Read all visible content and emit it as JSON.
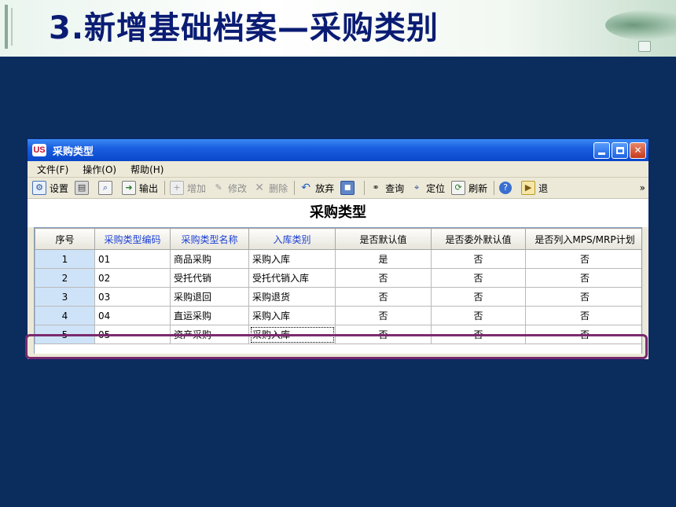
{
  "slide": {
    "title": "3.新增基础档案—采购类别"
  },
  "window": {
    "title": "采购类型",
    "app_icon_text": "US"
  },
  "menu": [
    {
      "label": "文件(F)"
    },
    {
      "label": "操作(O)"
    },
    {
      "label": "帮助(H)"
    }
  ],
  "toolbar": {
    "settings": "设置",
    "output": "输出",
    "add": "增加",
    "edit": "修改",
    "delete": "删除",
    "discard": "放弃",
    "query": "查询",
    "locate": "定位",
    "refresh": "刷新",
    "exit": "退",
    "overflow": "»"
  },
  "form_title": "采购类型",
  "table": {
    "headers": [
      "序号",
      "采购类型编码",
      "采购类型名称",
      "入库类别",
      "是否默认值",
      "是否委外默认值",
      "是否列入MPS/MRP计划"
    ],
    "rows": [
      [
        "1",
        "01",
        "商品采购",
        "采购入库",
        "是",
        "否",
        "否"
      ],
      [
        "2",
        "02",
        "受托代销",
        "受托代销入库",
        "否",
        "否",
        "否"
      ],
      [
        "3",
        "03",
        "采购退回",
        "采购退货",
        "否",
        "否",
        "否"
      ],
      [
        "4",
        "04",
        "直运采购",
        "采购入库",
        "否",
        "否",
        "否"
      ],
      [
        "5",
        "05",
        "资产采购",
        "采购入库",
        "否",
        "否",
        "否"
      ]
    ]
  },
  "colors": {
    "slide_background": "#0b2d5e",
    "title_text": "#0a1c73",
    "highlight_border": "#7a2a6e",
    "seq_column": "#cfe3f8"
  }
}
